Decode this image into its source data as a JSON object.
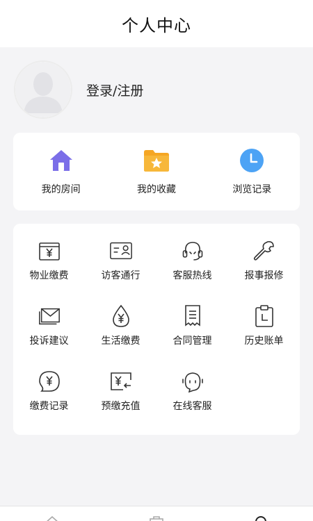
{
  "header": {
    "title": "个人中心"
  },
  "profile": {
    "login_label": "登录/注册"
  },
  "quick": [
    {
      "label": "我的房间",
      "icon": "house-icon"
    },
    {
      "label": "我的收藏",
      "icon": "star-folder-icon"
    },
    {
      "label": "浏览记录",
      "icon": "clock-icon"
    }
  ],
  "services": [
    {
      "label": "物业缴费",
      "icon": "yen-register-icon"
    },
    {
      "label": "访客通行",
      "icon": "visitor-card-icon"
    },
    {
      "label": "客服热线",
      "icon": "headset-icon"
    },
    {
      "label": "报事报修",
      "icon": "wrench-icon"
    },
    {
      "label": "投诉建议",
      "icon": "envelope-icon"
    },
    {
      "label": "生活缴费",
      "icon": "yen-drop-icon"
    },
    {
      "label": "合同管理",
      "icon": "document-icon"
    },
    {
      "label": "历史账单",
      "icon": "clipboard-clock-icon"
    },
    {
      "label": "缴费记录",
      "icon": "yen-bubble-icon"
    },
    {
      "label": "预缴充值",
      "icon": "yen-card-icon"
    },
    {
      "label": "在线客服",
      "icon": "chat-bubble-icon"
    }
  ],
  "tabbar": {
    "icons": [
      "home-icon",
      "briefcase-icon",
      "search-icon"
    ]
  },
  "colors": {
    "house": "#7b6ee8",
    "folder": "#f5a623",
    "clock": "#4da3f5"
  }
}
